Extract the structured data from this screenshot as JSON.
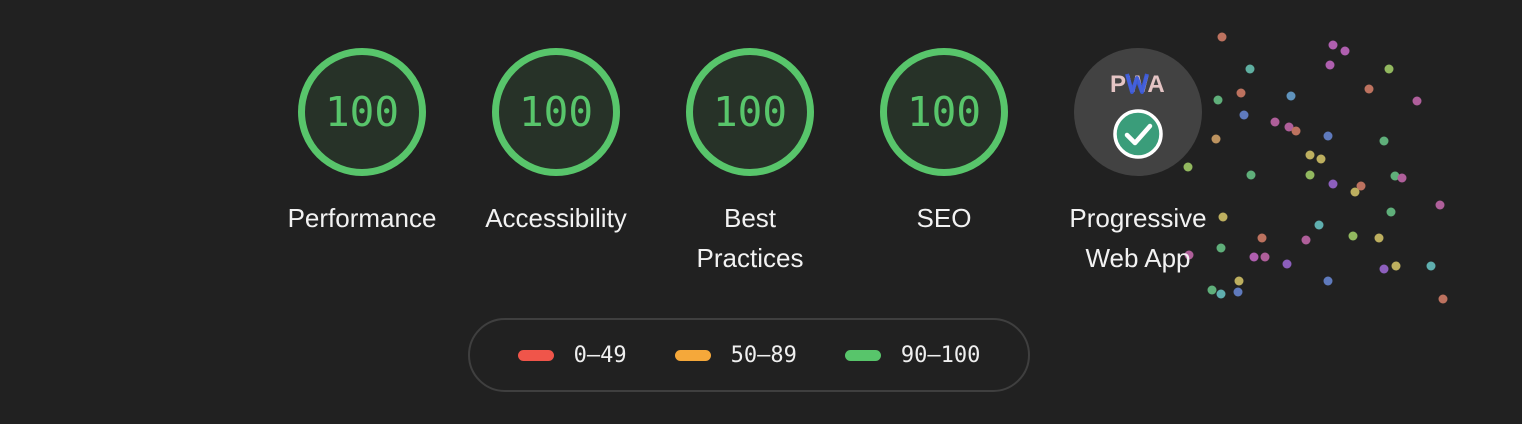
{
  "gauges": [
    {
      "score": "100",
      "label": "Performance"
    },
    {
      "score": "100",
      "label": "Accessibility"
    },
    {
      "score": "100",
      "label": "Best Practices"
    },
    {
      "score": "100",
      "label": "SEO"
    }
  ],
  "pwa": {
    "logo_text": "PWA",
    "label": "Progressive Web App",
    "status": "pass"
  },
  "legend": [
    {
      "range": "0–49",
      "color": "#f0554a"
    },
    {
      "range": "50–89",
      "color": "#f5a83a"
    },
    {
      "range": "90–100",
      "color": "#58c56b"
    }
  ],
  "colors": {
    "pass": "#58c56b",
    "background": "#212121",
    "pwa_circle": "#424242"
  }
}
